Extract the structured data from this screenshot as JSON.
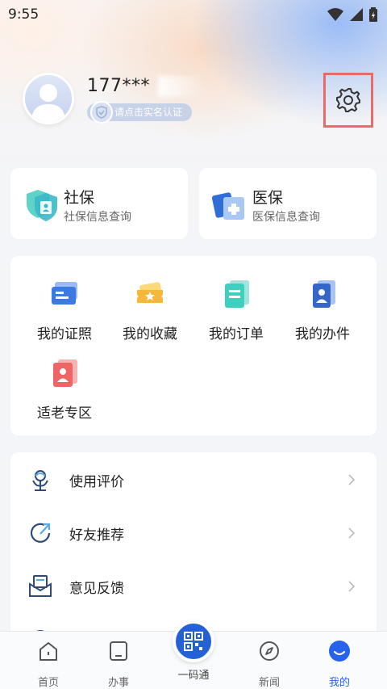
{
  "status_bar": {
    "time": "9:55"
  },
  "profile": {
    "phone": "177***",
    "verify_label": "请点击实名认证"
  },
  "insurance": [
    {
      "title": "社保",
      "subtitle": "社保信息查询",
      "icon": "social-security-icon"
    },
    {
      "title": "医保",
      "subtitle": "医保信息查询",
      "icon": "medical-insurance-icon"
    }
  ],
  "grid": [
    {
      "label": "我的证照",
      "icon": "license-card-icon"
    },
    {
      "label": "我的收藏",
      "icon": "favorites-ticket-icon"
    },
    {
      "label": "我的订单",
      "icon": "order-document-icon"
    },
    {
      "label": "我的办件",
      "icon": "case-file-icon"
    },
    {
      "label": "适老专区",
      "icon": "elderly-zone-icon"
    }
  ],
  "list": [
    {
      "label": "使用评价",
      "icon": "evaluation-icon"
    },
    {
      "label": "好友推荐",
      "icon": "share-icon"
    },
    {
      "label": "意见反馈",
      "icon": "feedback-icon"
    }
  ],
  "tabbar": {
    "tabs": [
      {
        "label": "首页",
        "icon": "home-icon"
      },
      {
        "label": "办事",
        "icon": "affairs-icon"
      },
      {
        "label": "一码通",
        "icon": "qr-code-icon"
      },
      {
        "label": "新闻",
        "icon": "compass-icon"
      },
      {
        "label": "我的",
        "icon": "profile-icon",
        "active": true
      }
    ]
  },
  "colors": {
    "accent": "#2563eb",
    "highlight_border": "#e86a6a"
  }
}
